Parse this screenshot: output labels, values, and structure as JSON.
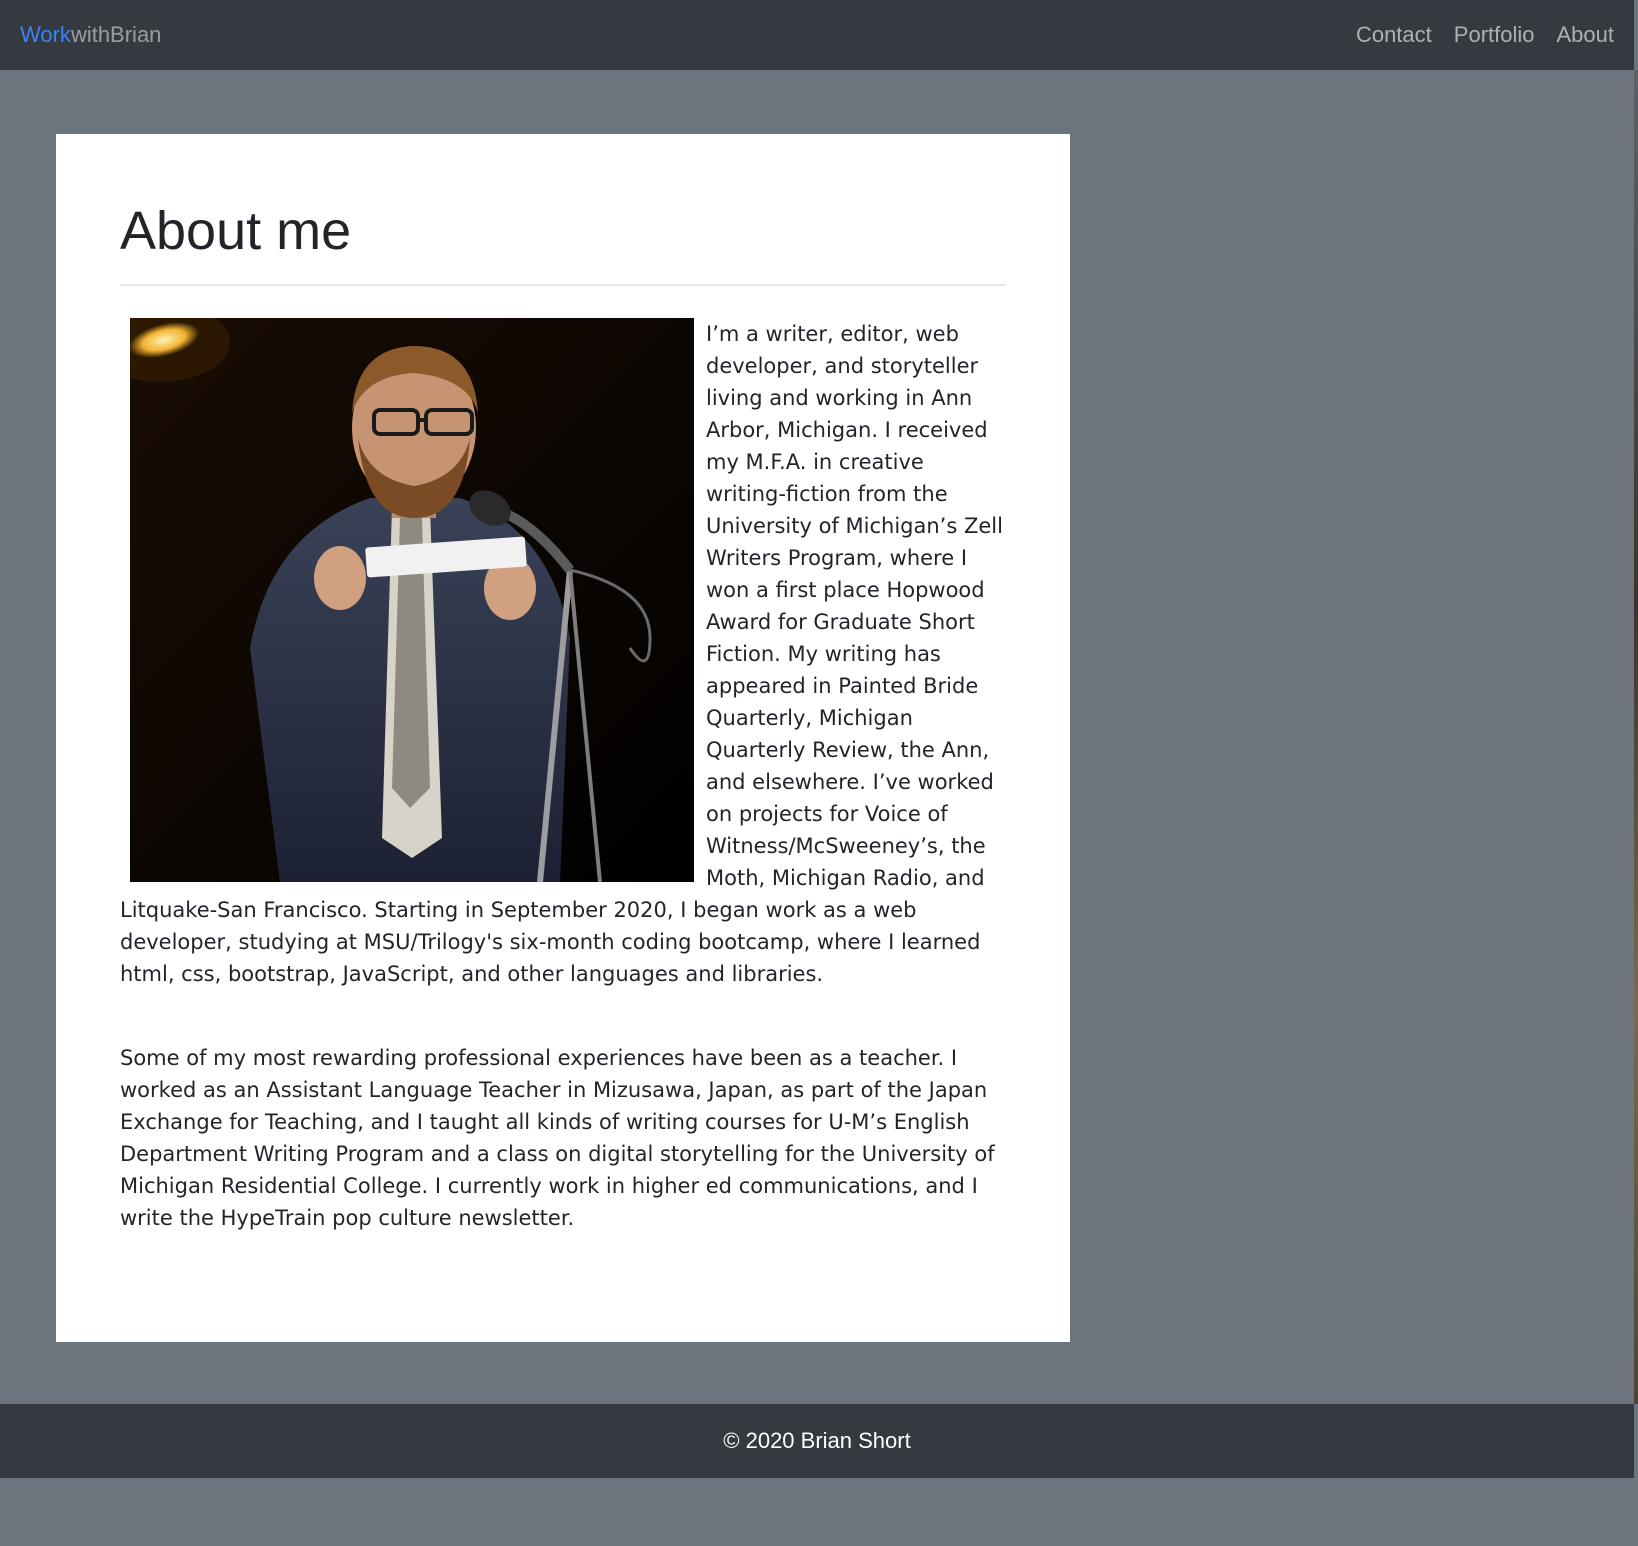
{
  "navbar": {
    "brand_accent": "Work",
    "brand_rest": "withBrian",
    "links": [
      "Contact",
      "Portfolio",
      "About"
    ]
  },
  "main": {
    "title": "About me",
    "photo": {
      "subject": "man-with-microphone-photo"
    },
    "paragraphs": [
      "I’m a writer, editor, web developer, and storyteller living and working in Ann Arbor, Michigan. I received my M.F.A. in creative writing-fiction from the University of Michigan’s Zell Writers Program, where I won a first place Hopwood Award for Graduate Short Fiction. My writing has appeared in Painted Bride Quarterly, Michigan Quarterly Review, the Ann, and elsewhere. I’ve worked on projects for Voice of Witness/McSweeney’s, the Moth, Michigan Radio, and Litquake-San Francisco. Starting in September 2020, I began work as a web developer, studying at MSU/Trilogy's six-month coding bootcamp, where I learned html, css, bootstrap, JavaScript, and other languages and libraries.",
      "Some of my most rewarding professional experiences have been as a teacher. I worked as an Assistant Language Teacher in Mizusawa, Japan, as part of the Japan Exchange for Teaching, and I taught all kinds of writing courses for U-M’s English Department Writing Program and a class on digital storytelling for the University of Michigan Residential College. I currently work in higher ed communications, and I write the HypeTrain pop culture newsletter."
    ]
  },
  "footer": {
    "copyright": "© 2020 Brian Short"
  },
  "colors": {
    "navbar_bg": "#343a40",
    "page_bg": "#6c757d",
    "brand_accent": "#3b82f6",
    "card_bg": "#ffffff"
  }
}
